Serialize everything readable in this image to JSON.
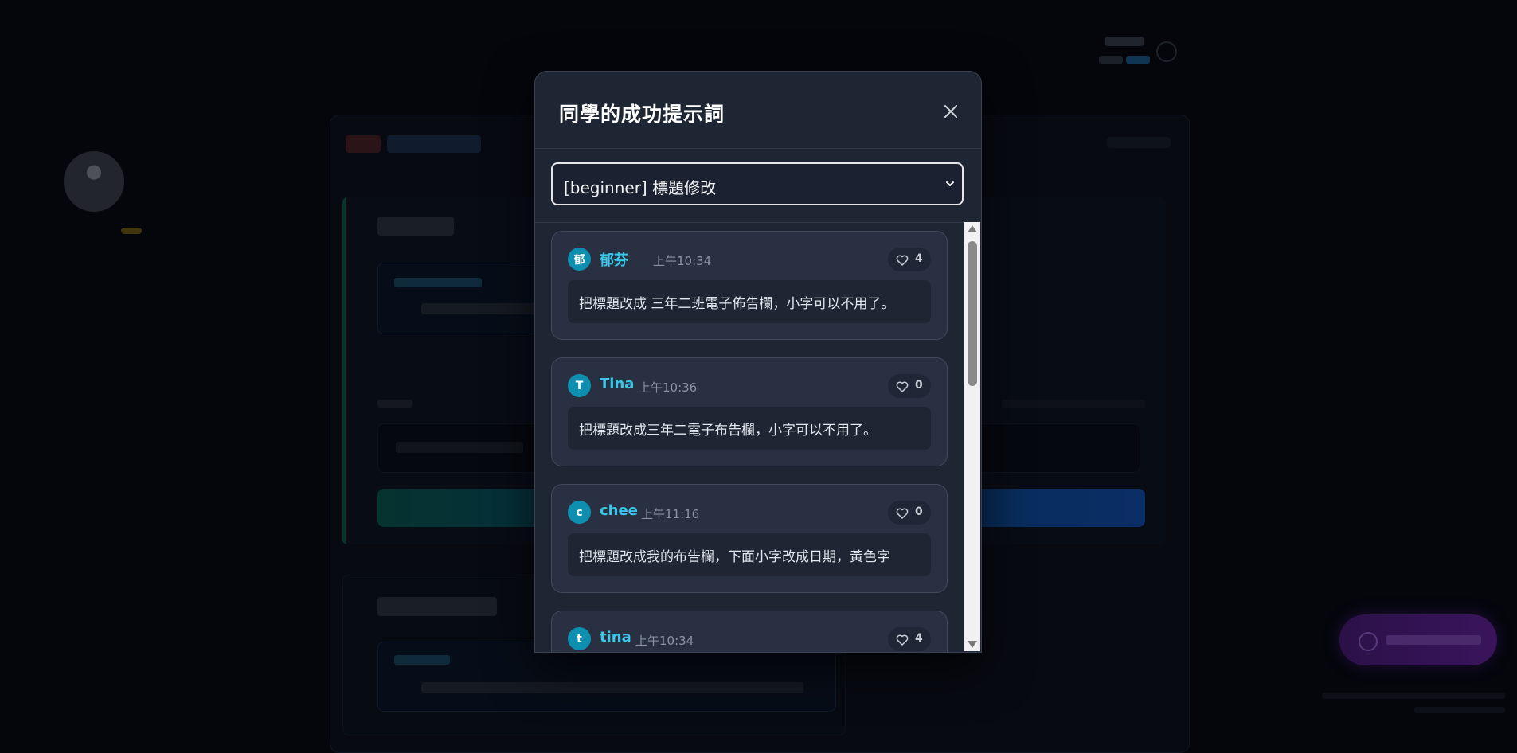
{
  "modal": {
    "title": "同學的成功提示詞",
    "close_icon": "close-icon",
    "select": {
      "selected": "[beginner] 標題修改",
      "arrow_icon": "chevron-down-icon"
    }
  },
  "posts": [
    {
      "initial": "郁",
      "author": "郁芬",
      "time": "上午10:34",
      "likes": "4",
      "text": "把標題改成  三年二班電子佈告欄，小字可以不用了。"
    },
    {
      "initial": "T",
      "author": "Tina",
      "time": "上午10:36",
      "likes": "0",
      "text": "把標題改成三年二電子布告欄，小字可以不用了。"
    },
    {
      "initial": "c",
      "author": "chee",
      "time": "上午11:16",
      "likes": "0",
      "text": "把標題改成我的布告欄，下面小字改成日期，黃色字"
    },
    {
      "initial": "t",
      "author": "tina",
      "time": "上午10:34",
      "likes": "4",
      "text": ""
    }
  ],
  "colors": {
    "accent": "#3cc6ea",
    "avatar_bg": "#0e8fb0",
    "modal_bg": "#1e2533",
    "card_bg": "#283041"
  },
  "icons": {
    "like": "heart-icon"
  }
}
